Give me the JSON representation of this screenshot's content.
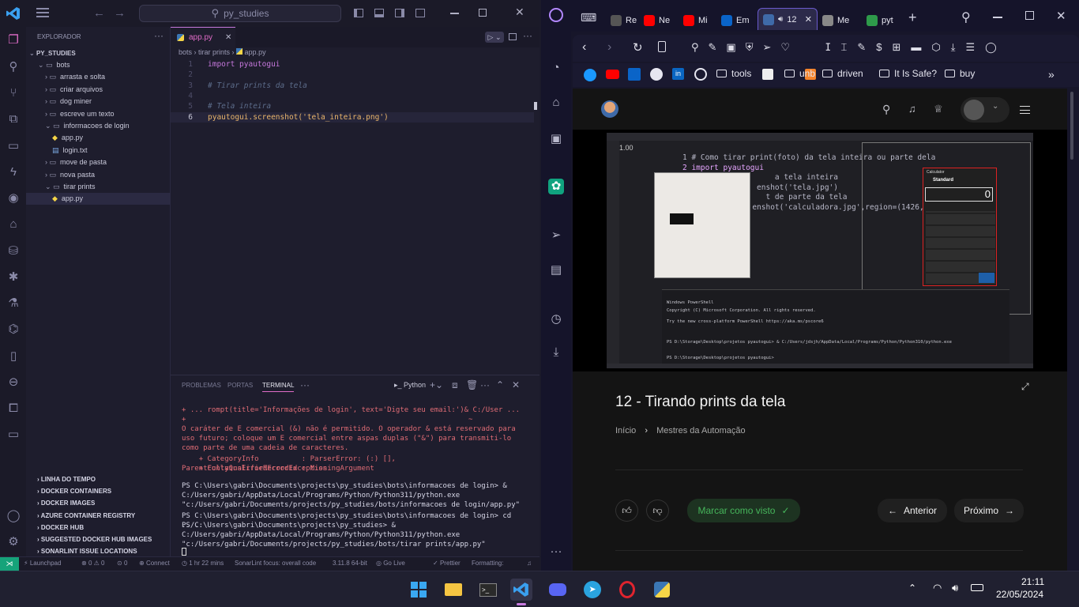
{
  "vscode": {
    "search": "py_studies",
    "explorer_title": "EXPLORADOR",
    "root": "PY_STUDIES",
    "tree": [
      {
        "label": "bots",
        "type": "folder-open",
        "depth": 1
      },
      {
        "label": "arrasta e solta",
        "type": "folder",
        "depth": 2
      },
      {
        "label": "criar arquivos",
        "type": "folder",
        "depth": 2
      },
      {
        "label": "dog miner",
        "type": "folder",
        "depth": 2
      },
      {
        "label": "escreve um texto",
        "type": "folder",
        "depth": 2
      },
      {
        "label": "informacoes de login",
        "type": "folder-open",
        "depth": 2
      },
      {
        "label": "app.py",
        "type": "py",
        "depth": 3
      },
      {
        "label": "login.txt",
        "type": "txt",
        "depth": 3
      },
      {
        "label": "move de pasta",
        "type": "folder",
        "depth": 2
      },
      {
        "label": "nova pasta",
        "type": "folder",
        "depth": 2
      },
      {
        "label": "tirar prints",
        "type": "folder-open",
        "depth": 2
      },
      {
        "label": "app.py",
        "type": "py",
        "depth": 3
      }
    ],
    "bottom_sections": [
      "LINHA DO TEMPO",
      "DOCKER CONTAINERS",
      "DOCKER IMAGES",
      "AZURE CONTAINER REGISTRY",
      "DOCKER HUB",
      "SUGGESTED DOCKER HUB IMAGES",
      "SONARLINT ISSUE LOCATIONS"
    ],
    "tab_label": "app.py",
    "breadcrumb": [
      "bots",
      "tirar prints",
      "app.py"
    ],
    "code": [
      {
        "n": "1",
        "text": "import pyautogui"
      },
      {
        "n": "2",
        "text": ""
      },
      {
        "n": "3",
        "text": "# Tirar prints da tela"
      },
      {
        "n": "4",
        "text": ""
      },
      {
        "n": "5",
        "text": "# Tela inteira"
      },
      {
        "n": "6",
        "text": "pyautogui.screenshot('tela_inteira.png')"
      }
    ],
    "panel_tabs": [
      "PROBLEMAS",
      "PORTAS",
      "TERMINAL"
    ],
    "panel_python": "Python",
    "terminal": [
      "+ ... rompt(title='Informações de login', text='Digte seu email:')& C:/User ...",
      "+                                                                  ~",
      "O caráter de E comercial (&) não é permitido. O operador & está reservado para uso futuro; coloque um E comercial entre aspas duplas (\"&\") para transmiti-lo como parte de uma cadeia de caracteres.",
      "    + CategoryInfo          : ParserError: (:) [], ParentContainsErrorRecordException",
      "    + FullyQualifiedErrorId : MissingArgument",
      "",
      "PS C:\\Users\\gabri\\Documents\\projects\\py_studies\\bots\\informacoes de login> & C:/Users/gabri/AppData/Local/Programs/Python/Python311/python.exe \"c:/Users/gabri/Documents/projects/py_studies/bots/informacoes de login/app.py\"",
      "PS C:\\Users\\gabri\\Documents\\projects\\py_studies\\bots\\informacoes de login> cd ../..",
      "PS C:\\Users\\gabri\\Documents\\projects\\py_studies> & C:/Users/gabri/AppData/Local/Programs/Python/Python311/python.exe \"c:/Users/gabri/Documents/projects/py_studies/bots/tirar prints/app.py\""
    ],
    "status": {
      "launchpad": "Launchpad",
      "errors": "0",
      "warnings": "0",
      "ports": "0",
      "connect": "Connect",
      "time": "1 hr 22 mins",
      "sonar": "SonarLint focus: overall code",
      "python": "3.11.8 64-bit",
      "golive": "Go Live",
      "prettier": "Prettier",
      "formatting": "Formatting:"
    }
  },
  "opera": {
    "tabs": [
      "Re",
      "Ne",
      "Mi",
      "Em",
      "12",
      "Me",
      "pyt"
    ],
    "bookmarks": [
      "tools",
      "unb",
      "driven",
      "It Is Safe?",
      "buy"
    ],
    "lesson_title": "12 - Tirando prints da tela",
    "breadcrumb_home": "Início",
    "breadcrumb_course": "Mestres da Automação",
    "btn_mark": "Marcar como visto",
    "btn_prev": "Anterior",
    "btn_next": "Próximo",
    "video": {
      "code_lines": [
        "1 # Como tirar print(foto) da tela inteira ou parte dela",
        "2 import pyautogui",
        "           a tela inteira",
        "       enshot('tela.jpg')",
        "         t de parte da tela",
        "      enshot('calculadora.jpg',region=(1426,159,d"
      ],
      "calc_title": "Calculator",
      "calc_mode": "Standard",
      "calc_value": "0",
      "ps_lines": [
        "Windows PowerShell",
        "Copyright (C) Microsoft Corporation. All rights reserved.",
        "Try the new cross-platform PowerShell https://aka.ms/pscore6",
        "PS D:\\Storage\\Desktop\\projetos pyautogui> & C:/Users/jdsjh/AppData/Local/Programs/Python/Python310/python.exe",
        "PS D:\\Storage\\Desktop\\projetos pyautogui>"
      ]
    }
  },
  "taskbar": {
    "time": "21:11",
    "date": "22/05/2024"
  }
}
